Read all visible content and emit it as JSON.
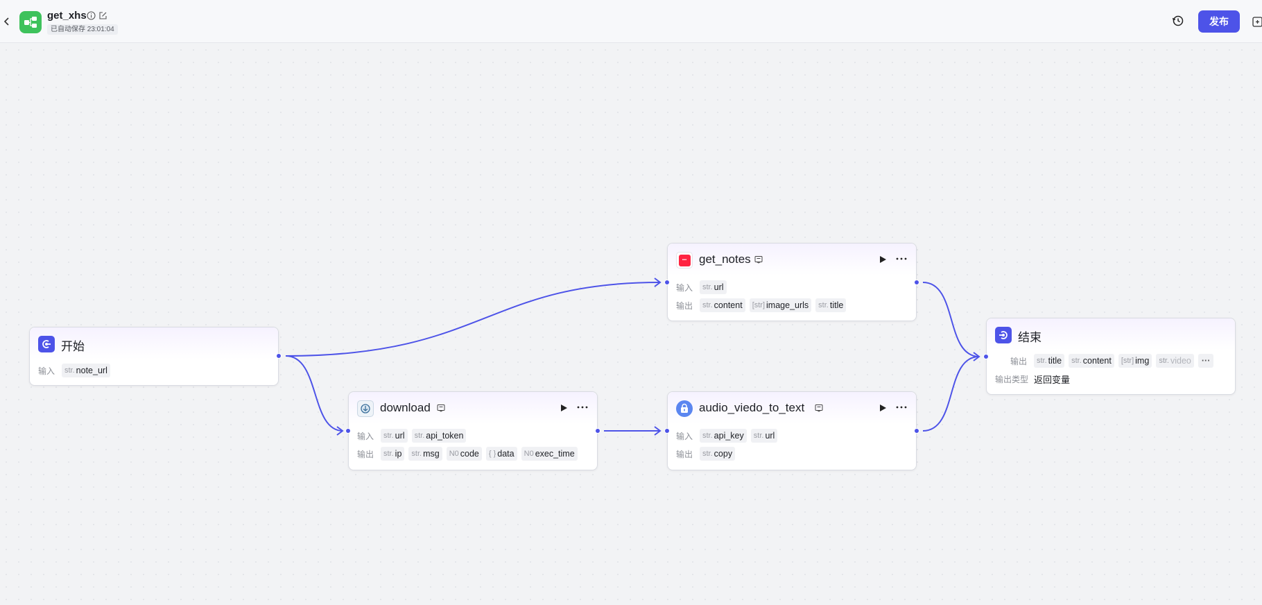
{
  "header": {
    "title": "get_xhs",
    "autosave_text": "已自动保存 23:01:04",
    "publish_label": "发布"
  },
  "colors": {
    "accent": "#4d53e8",
    "app_icon_bg": "#3ec25c",
    "edge": "#4d53e8"
  },
  "nodes": {
    "start": {
      "title": "开始",
      "icon": "start-icon",
      "inputs_label": "输入",
      "inputs": [
        {
          "type": "str.",
          "name": "note_url"
        }
      ]
    },
    "get_notes": {
      "title": "get_notes",
      "icon": "xiaohongshu-plugin-icon",
      "inputs_label": "输入",
      "outputs_label": "输出",
      "inputs": [
        {
          "type": "str.",
          "name": "url"
        }
      ],
      "outputs": [
        {
          "type": "str.",
          "name": "content"
        },
        {
          "type": "[str]",
          "name": "image_urls"
        },
        {
          "type": "str.",
          "name": "title"
        }
      ]
    },
    "download": {
      "title": "download",
      "icon": "download-plugin-icon",
      "inputs_label": "输入",
      "outputs_label": "输出",
      "inputs": [
        {
          "type": "str.",
          "name": "url"
        },
        {
          "type": "str.",
          "name": "api_token"
        }
      ],
      "outputs": [
        {
          "type": "str.",
          "name": "ip"
        },
        {
          "type": "str.",
          "name": "msg"
        },
        {
          "type": "N0",
          "name": "code"
        },
        {
          "type": "{ }",
          "name": "data"
        },
        {
          "type": "N0",
          "name": "exec_time"
        }
      ]
    },
    "audio_to_text": {
      "title": "audio_viedo_to_text",
      "icon": "audio-to-text-plugin-icon",
      "inputs_label": "输入",
      "outputs_label": "输出",
      "inputs": [
        {
          "type": "str.",
          "name": "api_key"
        },
        {
          "type": "str.",
          "name": "url"
        }
      ],
      "outputs": [
        {
          "type": "str.",
          "name": "copy"
        }
      ]
    },
    "end": {
      "title": "结束",
      "icon": "end-icon",
      "outputs_label": "输出",
      "outputs": [
        {
          "type": "str.",
          "name": "title"
        },
        {
          "type": "str.",
          "name": "content"
        },
        {
          "type": "[str]",
          "name": "img"
        },
        {
          "type": "str.",
          "name": "video"
        }
      ],
      "more_label": "···",
      "output_type_label": "输出类型",
      "output_type_value": "返回变量"
    }
  }
}
